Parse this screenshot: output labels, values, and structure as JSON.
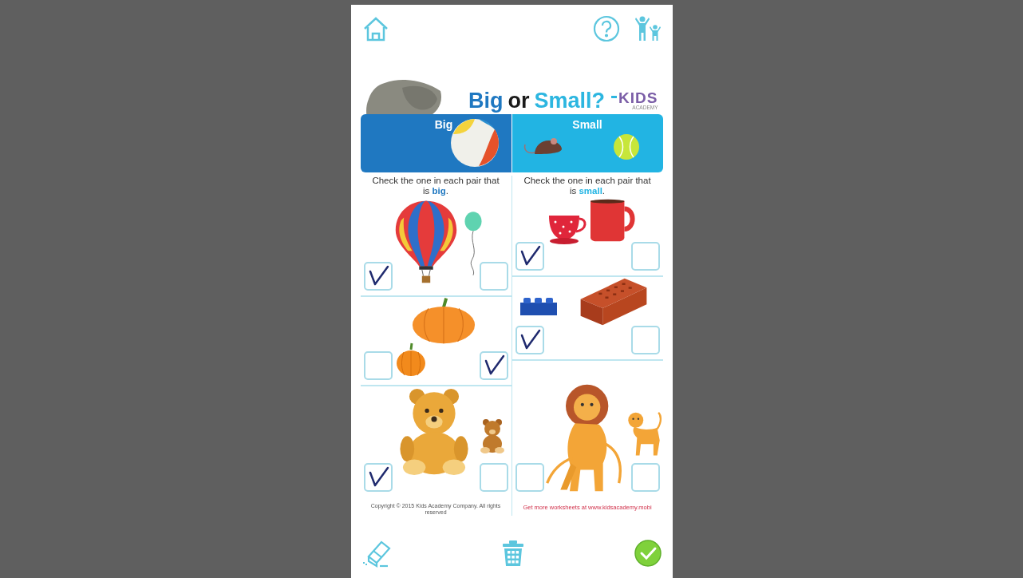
{
  "top_bar": {
    "buttons": [
      {
        "kind": "home"
      },
      {
        "kind": "help"
      },
      {
        "kind": "parents"
      }
    ]
  },
  "worksheet": {
    "title": [
      {
        "text": "Big",
        "color": "#1f78c1"
      },
      {
        "text": "or",
        "color": "#1a1a1a"
      },
      {
        "text": "Small?",
        "color": "#2cb6e0"
      }
    ],
    "logo": {
      "text": "KIDS",
      "subtext": "ACADEMY"
    },
    "columns": [
      {
        "header": "Big",
        "color": "#1f78c1",
        "instruction": "Check the one in each pair that is **big**.",
        "pairs": [
          {
            "items": [
              {
                "kind": "hot-air-balloon",
                "checked": true
              },
              {
                "kind": "balloon",
                "checked": false
              }
            ]
          },
          {
            "items": [
              {
                "kind": "small-pumpkin",
                "checked": false
              },
              {
                "kind": "big-pumpkin",
                "checked": true
              }
            ]
          },
          {
            "items": [
              {
                "kind": "big-teddy",
                "checked": true
              },
              {
                "kind": "small-teddy",
                "checked": false
              }
            ]
          }
        ]
      },
      {
        "header": "Small",
        "color": "#22b4e3",
        "instruction": "Check the one in each pair that is **small**.",
        "pairs": [
          {
            "items": [
              {
                "kind": "teacup",
                "checked": true
              },
              {
                "kind": "mug",
                "checked": false
              }
            ]
          },
          {
            "items": [
              {
                "kind": "toy-brick",
                "checked": true
              },
              {
                "kind": "brick",
                "checked": false
              }
            ]
          },
          {
            "items": [
              {
                "kind": "lion",
                "checked": false
              },
              {
                "kind": "lion-cub",
                "checked": false
              }
            ]
          }
        ]
      }
    ],
    "copyright": "Copyright © 2015 Kids Academy Company. All rights reserved",
    "link": "Get more worksheets at www.kidsacademy.mobi"
  },
  "bottom_bar": {
    "buttons": [
      {
        "kind": "eraser"
      },
      {
        "kind": "trash"
      },
      {
        "kind": "done"
      }
    ]
  }
}
